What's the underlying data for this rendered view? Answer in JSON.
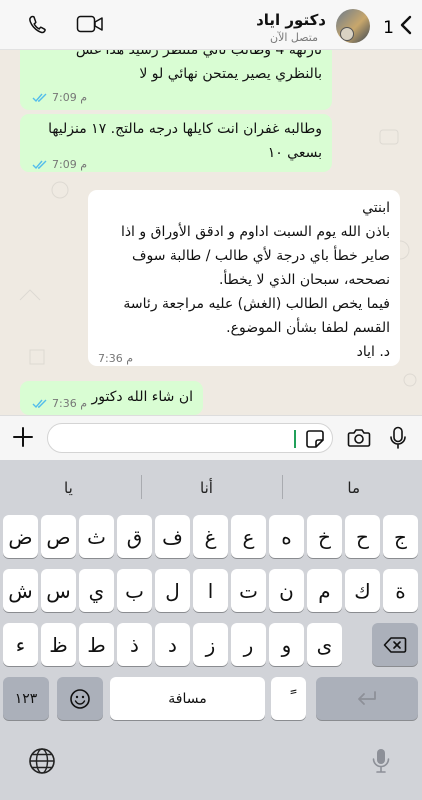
{
  "header": {
    "unread_count": "1",
    "contact_name": "دكتور اياد",
    "status": "متصل الآن"
  },
  "messages": [
    {
      "lines": [
        "نازلهة 4 وطالب ثاني منتظر رشيد هذا غش",
        "بالنظري يصير يمتحن نهائي لو لا"
      ],
      "time": "7:09 م"
    },
    {
      "lines": [
        "وطالبه غفران انت كايلها درجه مالتج. ١٧ منزليها",
        "بسعي ١٠"
      ],
      "time": "7:09 م"
    },
    {
      "lines": [
        "ابنتي",
        "باذن الله يوم السبت اداوم و ادقق الأوراق و اذا",
        "صاير خطأ باي درجة لأي طالب / طالبة سوف",
        "نصححه، سبحان الذي لا يخطأ.",
        "فيما يخص الطالب (الغش) عليه مراجعة رئاسة",
        "القسم لطفا بشأن الموضوع.",
        "د. اياد"
      ],
      "time": "7:36 م"
    },
    {
      "lines": [
        "ان شاء الله دكتور"
      ],
      "time": "7:36 م"
    }
  ],
  "suggestions": [
    "ما",
    "أنا",
    "يا"
  ],
  "keyboard": {
    "row1": [
      "ج",
      "ح",
      "خ",
      "ه",
      "ع",
      "غ",
      "ف",
      "ق",
      "ث",
      "ص",
      "ض"
    ],
    "row2": [
      "ة",
      "ك",
      "م",
      "ن",
      "ت",
      "ا",
      "ل",
      "ب",
      "ي",
      "س",
      "ش"
    ],
    "row3": [
      "ى",
      "و",
      "ر",
      "ز",
      "د",
      "ذ",
      "ط",
      "ظ",
      "ء"
    ],
    "numbers_key": "١٢٣",
    "space_label": "مسافة",
    "diacritic_key": "ً"
  },
  "colors": {
    "outgoing_bubble": "#d9fdd3",
    "incoming_bubble": "#ffffff",
    "read_ticks": "#53bdeb",
    "accent": "#21a05a"
  },
  "icons": [
    "phone-icon",
    "video-call-icon",
    "back-chevron-icon",
    "plus-icon",
    "sticker-icon",
    "camera-icon",
    "mic-icon",
    "emoji-icon",
    "backspace-icon",
    "return-icon",
    "globe-icon",
    "dictation-mic-icon"
  ]
}
